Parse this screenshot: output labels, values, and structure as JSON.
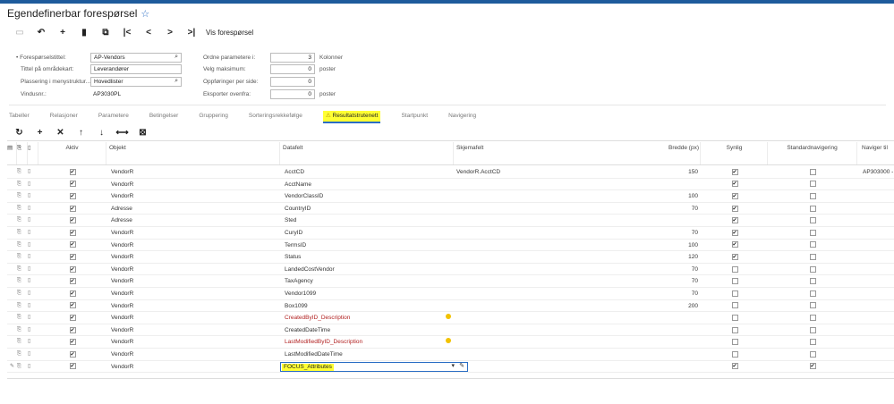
{
  "header": {
    "title": "Egendefinerbar forespørsel"
  },
  "toolbar": {
    "items": [
      {
        "name": "save-icon",
        "glyph": "💾"
      },
      {
        "name": "undo-icon",
        "glyph": "↶"
      },
      {
        "name": "add-icon",
        "glyph": "+"
      },
      {
        "name": "delete-icon",
        "glyph": "🗑"
      },
      {
        "name": "copy-icon",
        "glyph": "⧉"
      },
      {
        "name": "first-icon",
        "glyph": "|<"
      },
      {
        "name": "prev-icon",
        "glyph": "<"
      },
      {
        "name": "next-icon",
        "glyph": ">"
      },
      {
        "name": "last-icon",
        "glyph": ">|"
      }
    ],
    "view_label": "Vis forespørsel"
  },
  "form": {
    "title_label": "Forespørselstittel:",
    "title_value": "AP-Vendors",
    "sitemap_title_label": "Tittel på områdekart:",
    "sitemap_title_value": "Leverandører",
    "menu_location_label": "Plassering i menystruktur...",
    "menu_location_value": "Hovedlister",
    "screen_id_label": "Vindusnr.:",
    "screen_id_value": "AP3030PL",
    "arrange_label": "Ordne parametere i:",
    "arrange_value": "3",
    "arrange_unit": "Kolonner",
    "select_top_label": "Velg maksimum:",
    "select_top_value": "0",
    "select_top_unit": "poster",
    "records_per_page_label": "Oppføringer per side:",
    "records_per_page_value": "0",
    "export_top_label": "Eksporter ovenfra:",
    "export_top_value": "0",
    "export_top_unit": "poster"
  },
  "tabs": [
    "Tabeller",
    "Relasjoner",
    "Parametere",
    "Betingelser",
    "Gruppering",
    "Sorteringsrekkefølge",
    "Resultatstrutenett",
    "Startpunkt",
    "Navigering"
  ],
  "active_tab": "Resultatstrutenett",
  "grid": {
    "columns": {
      "active": "Aktiv",
      "object": "Objekt",
      "data_field": "Datafelt",
      "schema_field": "Skjemafelt",
      "width": "Bredde (px)",
      "visible": "Synlig",
      "default_nav": "Standardnavigering",
      "navigate_to": "Naviger til"
    },
    "rows": [
      {
        "active": true,
        "object": "VendorR",
        "field": "AcctCD",
        "schema": "VendorR.AcctCD",
        "width": "150",
        "visible": true,
        "nav": false,
        "navto": "AP303000 -",
        "warn": false
      },
      {
        "active": true,
        "object": "VendorR",
        "field": "AcctName",
        "schema": "",
        "width": "",
        "visible": true,
        "nav": false,
        "navto": "",
        "warn": false
      },
      {
        "active": true,
        "object": "VendorR",
        "field": "VendorClassID",
        "schema": "",
        "width": "100",
        "visible": true,
        "nav": false,
        "navto": "",
        "warn": false
      },
      {
        "active": true,
        "object": "Adresse",
        "field": "CountryID",
        "schema": "",
        "width": "70",
        "visible": true,
        "nav": false,
        "navto": "",
        "warn": false
      },
      {
        "active": true,
        "object": "Adresse",
        "field": "Sted",
        "schema": "",
        "width": "",
        "visible": true,
        "nav": false,
        "navto": "",
        "warn": false
      },
      {
        "active": true,
        "object": "VendorR",
        "field": "CuryID",
        "schema": "",
        "width": "70",
        "visible": true,
        "nav": false,
        "navto": "",
        "warn": false
      },
      {
        "active": true,
        "object": "VendorR",
        "field": "TermsID",
        "schema": "",
        "width": "100",
        "visible": true,
        "nav": false,
        "navto": "",
        "warn": false
      },
      {
        "active": true,
        "object": "VendorR",
        "field": "Status",
        "schema": "",
        "width": "120",
        "visible": true,
        "nav": false,
        "navto": "",
        "warn": false
      },
      {
        "active": true,
        "object": "VendorR",
        "field": "LandedCostVendor",
        "schema": "",
        "width": "70",
        "visible": false,
        "nav": false,
        "navto": "",
        "warn": false
      },
      {
        "active": true,
        "object": "VendorR",
        "field": "TaxAgency",
        "schema": "",
        "width": "70",
        "visible": false,
        "nav": false,
        "navto": "",
        "warn": false
      },
      {
        "active": true,
        "object": "VendorR",
        "field": "Vendor1099",
        "schema": "",
        "width": "70",
        "visible": false,
        "nav": false,
        "navto": "",
        "warn": false
      },
      {
        "active": true,
        "object": "VendorR",
        "field": "Box1099",
        "schema": "",
        "width": "200",
        "visible": false,
        "nav": false,
        "navto": "",
        "warn": false
      },
      {
        "active": true,
        "object": "VendorR",
        "field": "CreatedByID_Description",
        "schema": "",
        "width": "",
        "visible": false,
        "nav": false,
        "navto": "",
        "warn": true
      },
      {
        "active": true,
        "object": "VendorR",
        "field": "CreatedDateTime",
        "schema": "",
        "width": "",
        "visible": false,
        "nav": false,
        "navto": "",
        "warn": false
      },
      {
        "active": true,
        "object": "VendorR",
        "field": "LastModifiedByID_Description",
        "schema": "",
        "width": "",
        "visible": false,
        "nav": false,
        "navto": "",
        "warn": true
      },
      {
        "active": true,
        "object": "VendorR",
        "field": "LastModifiedDateTime",
        "schema": "",
        "width": "",
        "visible": false,
        "nav": false,
        "navto": "",
        "warn": false
      },
      {
        "active": true,
        "object": "VendorR",
        "field": "FOCUS_Attributes",
        "schema": "",
        "width": "",
        "visible": true,
        "nav": true,
        "navto": "",
        "warn": false,
        "editing": true
      }
    ]
  }
}
